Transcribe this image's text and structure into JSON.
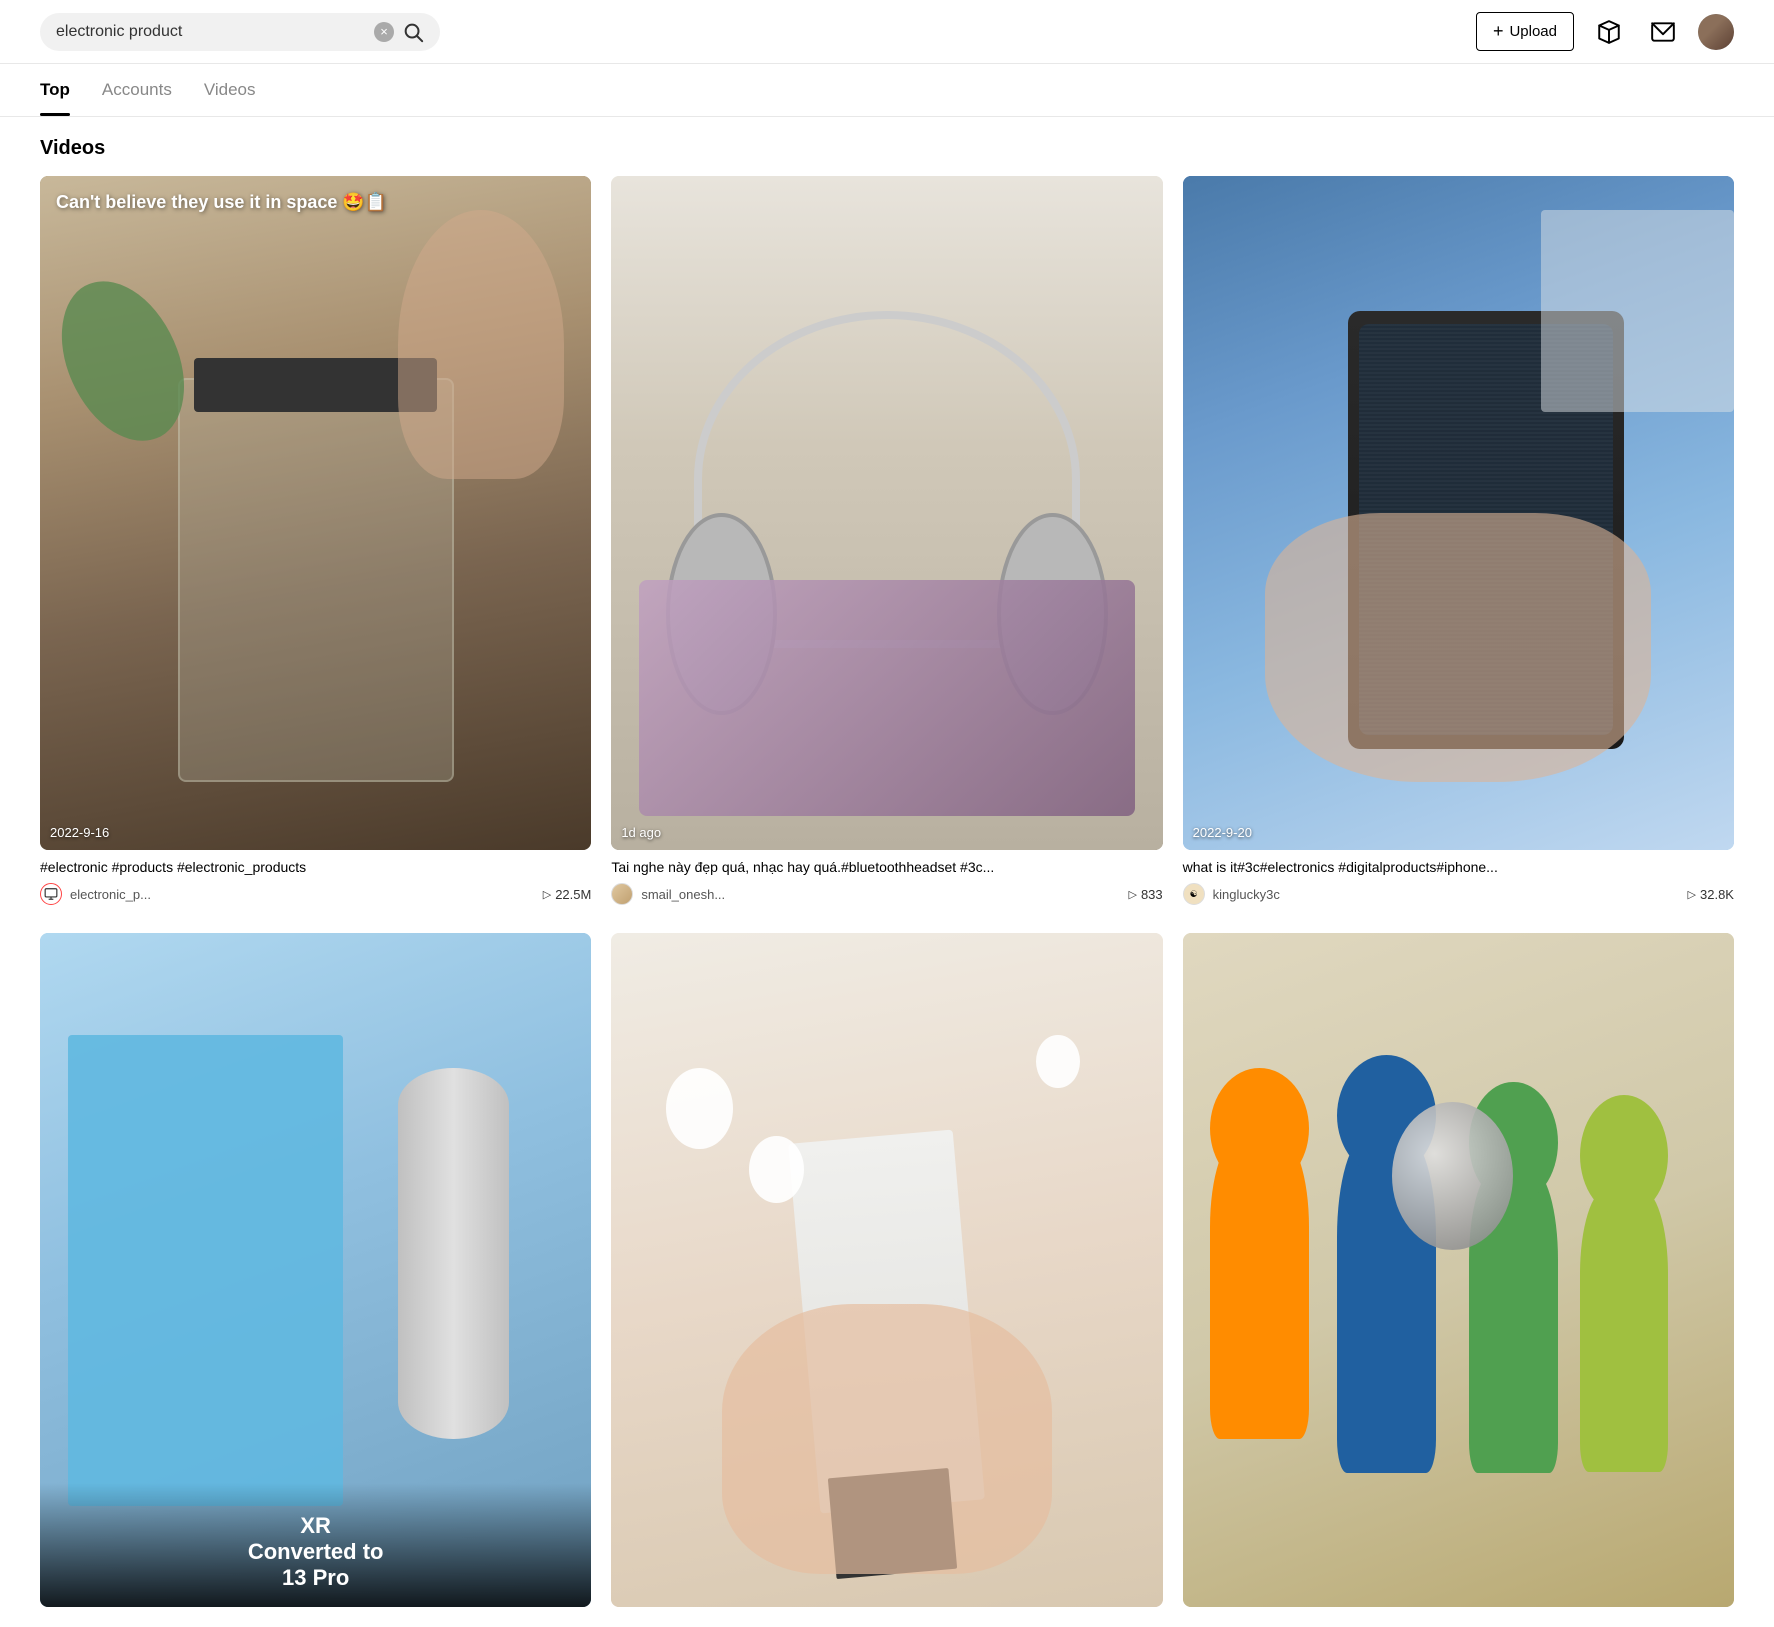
{
  "header": {
    "search_value": "electronic product",
    "search_clear_label": "×",
    "upload_label": "+ Upload",
    "upload_plus": "+",
    "upload_text": "Upload"
  },
  "tabs": [
    {
      "id": "top",
      "label": "Top",
      "active": true
    },
    {
      "id": "accounts",
      "label": "Accounts",
      "active": false
    },
    {
      "id": "videos",
      "label": "Videos",
      "active": false
    }
  ],
  "section": {
    "title": "Videos"
  },
  "videos": [
    {
      "id": 1,
      "overlay_text": "Can't believe they use it in space 🤩📋",
      "timestamp": "2022-9-16",
      "desc": "#electronic #products #electronic_products",
      "author": "electronic_p...",
      "views": "22.5M",
      "avatar_type": "icon"
    },
    {
      "id": 2,
      "overlay_text": "",
      "timestamp": "1d ago",
      "desc": "Tai nghe này đẹp quá, nhạc hay quá.#bluetoothheadset #3c...",
      "author": "smail_onesh...",
      "views": "833",
      "avatar_type": "plain"
    },
    {
      "id": 3,
      "overlay_text": "",
      "timestamp": "2022-9-20",
      "desc": "what is it#3c#electronics #digitalproducts#iphone...",
      "author": "kinglucky3c",
      "views": "32.8K",
      "avatar_type": "special"
    },
    {
      "id": 4,
      "overlay_text": "XR Converted to 13 Pro",
      "timestamp": "",
      "desc": "",
      "author": "",
      "views": "",
      "avatar_type": "none"
    },
    {
      "id": 5,
      "overlay_text": "",
      "timestamp": "",
      "desc": "",
      "author": "",
      "views": "",
      "avatar_type": "none"
    },
    {
      "id": 6,
      "overlay_text": "",
      "timestamp": "",
      "desc": "",
      "author": "",
      "views": "",
      "avatar_type": "none"
    }
  ]
}
